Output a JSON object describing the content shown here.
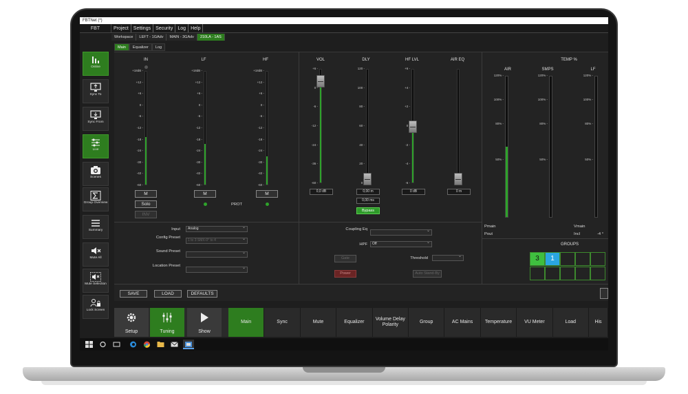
{
  "window": {
    "title": "FBTNet (*)",
    "app_label": "FBT"
  },
  "menu": [
    "Project",
    "Settings",
    "Security",
    "Log",
    "Help"
  ],
  "breadcrumbs": [
    "Workspace",
    "LEFT - 1GAdv",
    "MAIN - 3GAdv",
    "210LA - 1AS"
  ],
  "breadcrumb_active": 3,
  "sidebar": [
    {
      "label": "Online",
      "icon": "bar-chart-icon",
      "active": true
    },
    {
      "label": "Sync To",
      "icon": "monitor-up-icon",
      "active": false
    },
    {
      "label": "Sync From",
      "icon": "monitor-down-icon",
      "active": false
    },
    {
      "label": "Live",
      "icon": "sliders-icon",
      "active": true
    },
    {
      "label": "Scenes",
      "icon": "camera-icon",
      "active": false
    },
    {
      "label": "Group Overview",
      "icon": "sigma-icon",
      "active": false
    },
    {
      "label": "Summary",
      "icon": "list-icon",
      "active": false
    },
    {
      "label": "Mute All",
      "icon": "speaker-mute-icon",
      "active": false
    },
    {
      "label": "Mute Selection",
      "icon": "speaker-mute-selection-icon",
      "active": false
    },
    {
      "label": "Lock Screen",
      "icon": "users-lock-icon",
      "active": false
    }
  ],
  "subtabs": [
    "Main",
    "Equalizer",
    "Log"
  ],
  "inputs": {
    "IN": {
      "title": "IN",
      "level": 0.42
    },
    "LF": {
      "title": "LF",
      "level": 0.36
    },
    "HF": {
      "title": "HF",
      "level": 0.25
    },
    "scale": [
      "+18dB",
      "+12",
      "+6",
      "0",
      "-6",
      "-12",
      "-18",
      "-24",
      "-30",
      "-42",
      "-60"
    ],
    "mute_label": "M",
    "solo_label": "Solo",
    "inv_label": "INV",
    "prot_label": "PROT"
  },
  "outputs": {
    "vol": {
      "title": "VOL",
      "value": "0,0 dB",
      "scale": [
        "+6",
        "0",
        "-6",
        "-12",
        "-24",
        "-36",
        "-60"
      ]
    },
    "dly": {
      "title": "DLY",
      "value": "0,00 m",
      "value2": "0,00 ms",
      "scale": [
        "120",
        "100",
        "80",
        "60",
        "40",
        "20",
        "0"
      ],
      "bypass_label": "Bypass"
    },
    "hflvl": {
      "title": "HF LVL",
      "value": "0 dB",
      "scale": [
        "+6",
        "+4",
        "+2",
        "0",
        "-2",
        "-4",
        "-6"
      ]
    },
    "aireq": {
      "title": "AIR EQ",
      "value": "0 m"
    }
  },
  "temp": {
    "title": "TEMP %",
    "columns": [
      {
        "name": "AIR",
        "level": 0.5
      },
      {
        "name": "SMPS",
        "level": 0
      },
      {
        "name": "LF",
        "level": 0
      }
    ],
    "scale": [
      "120%",
      "100%",
      "80%",
      "50%"
    ],
    "pmain_label": "Pmain",
    "pout_label": "Pout",
    "vmain_label": "Vmain",
    "incl_label": "Incl",
    "incl_value": "-4 °",
    "groups_label": "GROUPS",
    "groups": [
      "3",
      "1"
    ]
  },
  "config": {
    "input_label": "Input",
    "input_value": "Analog",
    "config_preset_label": "Config Preset",
    "config_preset_value": "1 to 3 SMX-0° to 4",
    "sound_preset_label": "Sound Preset",
    "location_preset_label": "Location Preset",
    "coupling_label": "Coupling Eq",
    "hpf_label": "HPF",
    "hpf_value": "Off",
    "threshold_label": "Threshold",
    "gate_label": "Gate",
    "power_label": "Power",
    "autostandby_label": "Auto Stand-By"
  },
  "actions": {
    "save": "SAVE",
    "load": "LOAD",
    "defaults": "DEFAULTS"
  },
  "bottom_big": [
    {
      "label": "Setup",
      "icon": "gear-icon",
      "active": false
    },
    {
      "label": "Tuning",
      "icon": "sliders-icon",
      "active": true
    },
    {
      "label": "Show",
      "icon": "play-icon",
      "active": false
    }
  ],
  "bottom_tabs": [
    "Main",
    "Sync",
    "Mute",
    "Equalizer",
    "Volume Delay Polarity",
    "Group",
    "AC Mains",
    "Temperature",
    "VU Meter",
    "Load",
    "His"
  ],
  "bottom_tab_active": 0,
  "colors": {
    "accent": "#2e7d1f",
    "meter": "#2ea32a",
    "group_active": "#3fbf3f",
    "group_selected": "#2aa6e0"
  }
}
